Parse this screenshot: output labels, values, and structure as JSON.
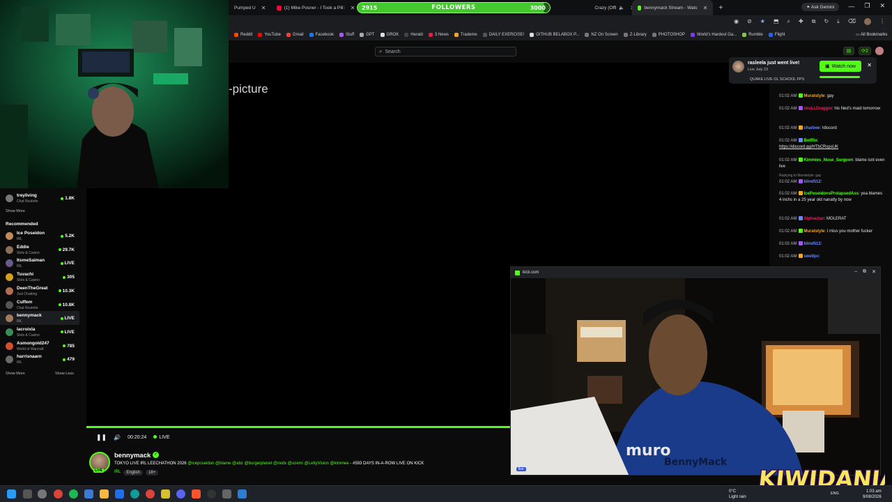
{
  "browser": {
    "tabs": [
      {
        "label": "Pumped U",
        "color": "#ff0033"
      },
      {
        "label": "(1) Mike Posner - I Took a Pill in",
        "color": "#ff0033"
      },
      {
        "label": "Crazy (Offi",
        "color": "#ff0033"
      },
      {
        "label": "bennymack Stream - Watc",
        "color": "#53fc18"
      }
    ],
    "ask_gemini": "Ask Gemini",
    "bookmarks": [
      {
        "label": "Reddit",
        "color": "#ff4500"
      },
      {
        "label": "YouTube",
        "color": "#ff0000"
      },
      {
        "label": "Gmail",
        "color": "#ea4335"
      },
      {
        "label": "Facebook",
        "color": "#1877f2"
      },
      {
        "label": "Stuff",
        "color": "#a855f7"
      },
      {
        "label": "GPT",
        "color": "#aaaaaa"
      },
      {
        "label": "GROK",
        "color": "#dddddd"
      },
      {
        "label": "Herald",
        "color": "#444444"
      },
      {
        "label": "3 News",
        "color": "#e11d48"
      },
      {
        "label": "Trademe",
        "color": "#f5a623"
      },
      {
        "label": "DAILY EXERCISE!",
        "color": "#555555"
      },
      {
        "label": "GITHUB BELABOX P...",
        "color": "#dddddd"
      },
      {
        "label": "NZ On Screen",
        "color": "#777777"
      },
      {
        "label": "Z-Library",
        "color": "#777777"
      },
      {
        "label": "PHOTOSHOP",
        "color": "#777777"
      },
      {
        "label": "World's Hardest Ga...",
        "color": "#7c3aed"
      },
      {
        "label": "Rumble",
        "color": "#85c742"
      },
      {
        "label": "Flight",
        "color": "#2563eb"
      }
    ],
    "all_bookmarks": "All Bookmarks"
  },
  "followers_goal": {
    "current": "2915",
    "label": "FOLLOWERS",
    "target": "3000",
    "fill_fraction": 0.97
  },
  "site": {
    "search_placeholder": "Search",
    "notif_count": "2",
    "pip_label": "-picture"
  },
  "notification": {
    "title": "rasleela just went live!",
    "subtitle": "Live July 23",
    "game": "QUAKE LIVE OL SCHOOL FPS",
    "watch_label": "Watch now"
  },
  "sidebar": {
    "top_item": {
      "name": "treyliving",
      "category": "Chat Roulette",
      "count": "1.8K"
    },
    "show_more_1": "Show More",
    "recommended_title": "Recommended",
    "items": [
      {
        "name": "Ice Poseidon",
        "category": "IRL",
        "count": "5.2K",
        "color": "#c08a5a"
      },
      {
        "name": "Eddie",
        "category": "Slots & Casino",
        "count": "29.7K",
        "color": "#8a6e5a"
      },
      {
        "name": "ItsmeSaiman",
        "category": "IRL",
        "count": "LIVE",
        "color": "#6a5a8a"
      },
      {
        "name": "Tuvachi",
        "category": "Slots & Casino",
        "count": "305",
        "color": "#d4a017"
      },
      {
        "name": "DeenTheGreat",
        "category": "Just Chatting",
        "count": "10.3K",
        "color": "#b07050"
      },
      {
        "name": "Cuffem",
        "category": "Chat Roulette",
        "count": "10.8K",
        "color": "#555555"
      },
      {
        "name": "bennymack",
        "category": "IRL",
        "count": "LIVE",
        "color": "#a07a5a"
      },
      {
        "name": "lacroixla",
        "category": "Slots & Casino",
        "count": "LIVE",
        "color": "#3a8a5a"
      },
      {
        "name": "Asmongold247",
        "category": "World of Warcraft",
        "count": "785",
        "color": "#d05030"
      },
      {
        "name": "harrisnaarn",
        "category": "IRL",
        "count": "479",
        "color": "#6a6a6a"
      }
    ],
    "show_more_2": "Show More",
    "show_less": "Show Less"
  },
  "player": {
    "time": "00:20:24",
    "live_label": "LIVE"
  },
  "stream": {
    "live_badge": "LIVE",
    "streamer": "bennymack",
    "title_prefix": "TOKYO LIVE IRL LEECHATHON 2026 ",
    "title_mentions": "@iceposeidon @blame @abz @burgerplanet @nedx @ozemi @LettyVision @kimmee",
    "title_suffix": " - #593 DAYS IN-A-ROW LIVE ON KICK",
    "category": "IRL",
    "tags": [
      "English",
      "18+"
    ]
  },
  "chat": [
    {
      "time": "01:02 AM",
      "user": "Muratstyle",
      "color": "#f5a623",
      "text": ": gay"
    },
    {
      "time": "01:02 AM",
      "user": "skuLLDragger",
      "color": "#e0245e",
      "text": ": his Ned's maid tomorrow"
    },
    {
      "time": "01:02 AM",
      "user": "charbee",
      "color": "#6b8afd",
      "text": ": !discord"
    },
    {
      "time": "01:02 AM",
      "user": "BotRix",
      "color": "#53fc18",
      "text": ":",
      "link": "https://discord.gg/HTbCRspsUK"
    },
    {
      "time": "01:02 AM",
      "user": "Kimmies_Nose_Surgeon",
      "color": "#53fc18",
      "text": ": blame isnt even live"
    },
    {
      "time": "01:02 AM",
      "reply": "Replying to Muratstyle: gay",
      "user": "blind512",
      "color": "#6b8afd",
      "text": ":"
    },
    {
      "time": "01:02 AM",
      "user": "IcePoseidonsProlapsedAss",
      "color": "#53fc18",
      "text": ": yea blames 4 inchs in a 25 year old nanatty by now"
    },
    {
      "time": "01:02 AM",
      "user": "Alphachar",
      "color": "#e0245e",
      "text": ": MOLERAT"
    },
    {
      "time": "01:02 AM",
      "user": "Muratstyle",
      "color": "#f5a623",
      "text": ": I miss you mother fucker"
    },
    {
      "time": "01:02 AM",
      "user": "blind512",
      "color": "#6b8afd",
      "text": ":"
    },
    {
      "time": "01:02 AM",
      "user": "swe0pc",
      "color": "#6b8afd",
      "text": ":"
    }
  ],
  "pip": {
    "url": "kick.com",
    "watermark": "BennyMack",
    "live_badge": "live"
  },
  "overlay_logo": "KIWIDANIA",
  "taskbar": {
    "weather_temp": "0°C",
    "weather_desc": "Light rain",
    "lang": "ENG",
    "time": "1:03 am",
    "date": "9/08/2026"
  }
}
